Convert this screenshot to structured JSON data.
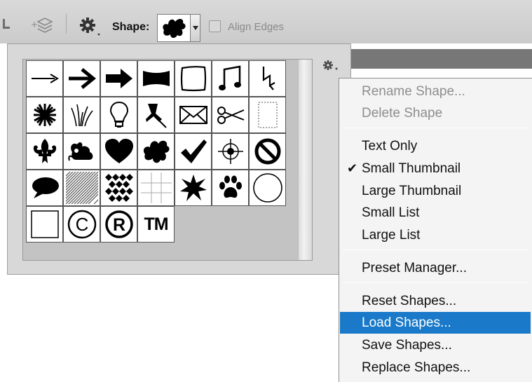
{
  "options_bar": {
    "icons": [
      "tool-icon",
      "layers-icon",
      "gear-icon"
    ],
    "shape_label": "Shape:",
    "shape_current_icon": "splat-shape-icon",
    "align_edges_label": "Align Edges",
    "align_edges_checked": false
  },
  "shape_picker": {
    "shapes": [
      "thin-arrow",
      "arrow",
      "bold-arrow",
      "banner",
      "square-frame",
      "music-notes",
      "lightning",
      "starburst",
      "grass",
      "lightbulb",
      "pushpin",
      "envelope",
      "scissors",
      "stamp-frame",
      "fleur-de-lis",
      "ornament",
      "heart",
      "splat",
      "checkmark",
      "target",
      "no-symbol",
      "speech-bubble",
      "diagonal-lines",
      "diamond-pattern",
      "grid",
      "explosion",
      "paw-print",
      "circle-frame",
      "square-frame-outline",
      "copyright",
      "registered",
      "trademark"
    ],
    "copyright_glyph": "©",
    "registered_glyph": "®",
    "trademark_glyph": "TM",
    "panel_menu_icon": "gear-icon"
  },
  "menu": {
    "items": [
      {
        "label": "Rename Shape...",
        "disabled": true
      },
      {
        "label": "Delete Shape",
        "disabled": true
      },
      {
        "label": "Text Only"
      },
      {
        "label": "Small Thumbnail",
        "checked": true
      },
      {
        "label": "Large Thumbnail"
      },
      {
        "label": "Small List"
      },
      {
        "label": "Large List"
      },
      {
        "label": "Preset Manager..."
      },
      {
        "label": "Reset Shapes..."
      },
      {
        "label": "Load Shapes...",
        "highlighted": true
      },
      {
        "label": "Save Shapes..."
      },
      {
        "label": "Replace Shapes..."
      }
    ],
    "check_glyph": "✔"
  },
  "colors": {
    "highlight": "#1a79c9",
    "menu_background": "#f4f4f4",
    "panel_background": "#d8d8d8"
  }
}
